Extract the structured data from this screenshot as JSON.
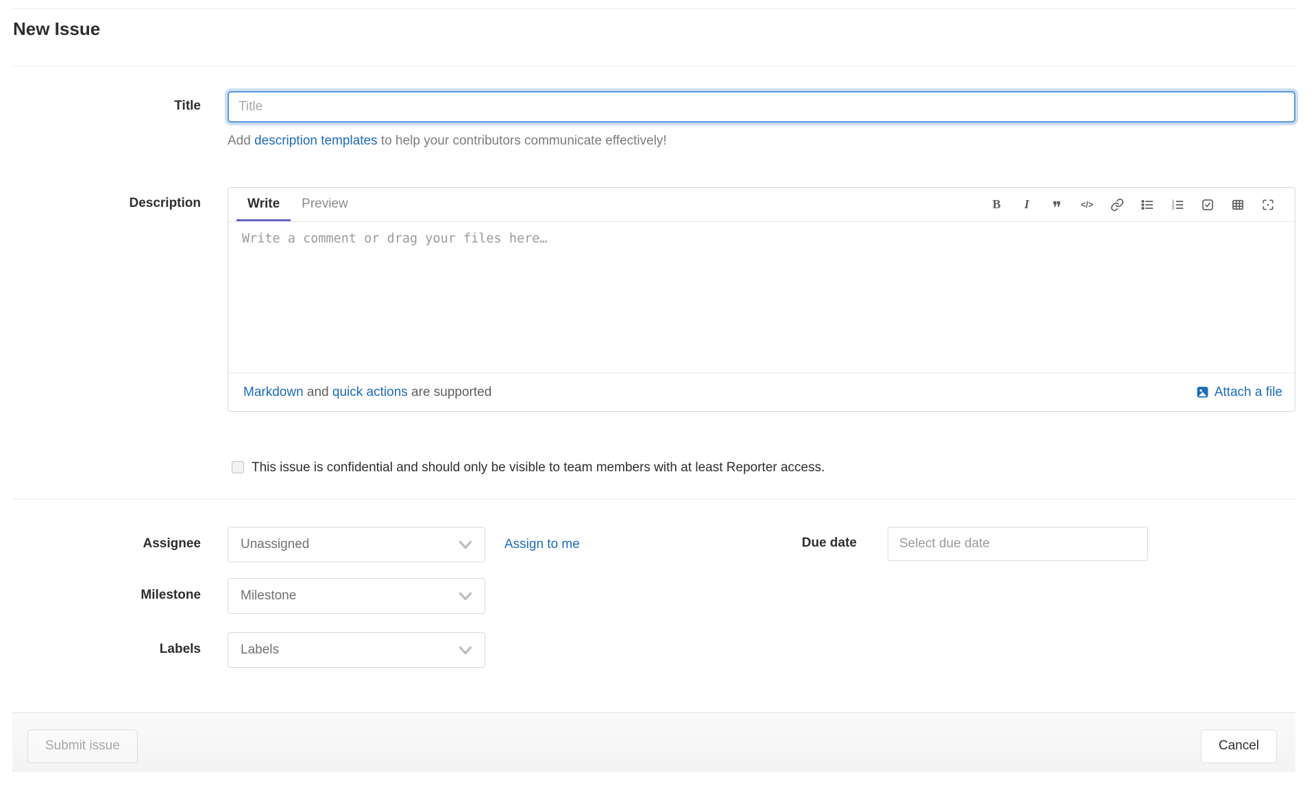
{
  "page": {
    "title": "New Issue"
  },
  "colors": {
    "link_blue": "#1b6bbd",
    "active_tab_underline": "#6666c4",
    "focus_border": "#5697dd"
  },
  "title_field": {
    "label": "Title",
    "value": "",
    "placeholder": "Title",
    "help_prefix": "Add ",
    "help_link": "description templates",
    "help_suffix": " to help your contributors communicate effectively!"
  },
  "description_field": {
    "label": "Description",
    "tabs": [
      {
        "label": "Write",
        "active": true
      },
      {
        "label": "Preview",
        "active": false
      }
    ],
    "toolbar_icons": [
      "bold-icon",
      "italic-icon",
      "quote-icon",
      "code-icon",
      "link-icon",
      "bulleted-list-icon",
      "numbered-list-icon",
      "task-list-icon",
      "table-icon",
      "fullscreen-icon"
    ],
    "value": "",
    "placeholder": "Write a comment or drag your files here…",
    "footer": {
      "markdown_link": "Markdown",
      "middle": " and ",
      "quick_actions_link": "quick actions",
      "suffix": " are supported",
      "attach_icon": "attach-image-icon",
      "attach_label": "Attach a file"
    }
  },
  "confidential": {
    "checked": false,
    "label": "This issue is confidential and should only be visible to team members with at least Reporter access."
  },
  "assignee": {
    "label": "Assignee",
    "value": "Unassigned",
    "assign_to_me": "Assign to me"
  },
  "due_date": {
    "label": "Due date",
    "value": "",
    "placeholder": "Select due date"
  },
  "milestone": {
    "label": "Milestone",
    "value": "Milestone"
  },
  "labels": {
    "label": "Labels",
    "value": "Labels"
  },
  "actions": {
    "submit": "Submit issue",
    "cancel": "Cancel"
  }
}
